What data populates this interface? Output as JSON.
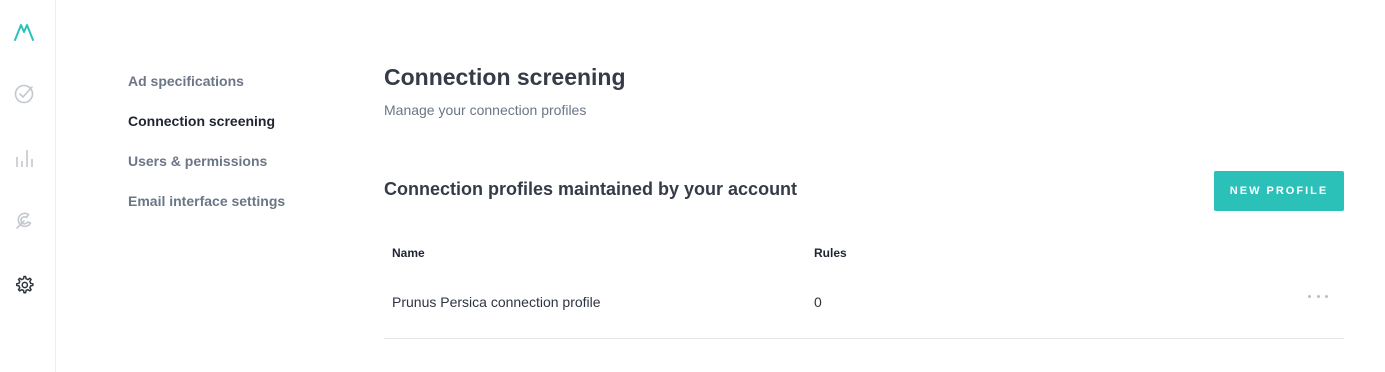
{
  "app": {
    "brand_color": "#2bc1b9"
  },
  "rail": {
    "icons": [
      {
        "name": "logo-icon"
      },
      {
        "name": "check-circle-icon"
      },
      {
        "name": "bar-chart-icon"
      },
      {
        "name": "wrench-icon"
      },
      {
        "name": "gear-icon",
        "active": true
      }
    ]
  },
  "subnav": {
    "items": [
      {
        "label": "Ad specifications"
      },
      {
        "label": "Connection screening",
        "active": true
      },
      {
        "label": "Users & permissions"
      },
      {
        "label": "Email interface settings"
      }
    ]
  },
  "page": {
    "title": "Connection screening",
    "subtitle": "Manage your connection profiles"
  },
  "profiles": {
    "section_title": "Connection profiles maintained by your account",
    "new_button_label": "NEW PROFILE",
    "columns": [
      "Name",
      "Rules"
    ],
    "rows": [
      {
        "name": "Prunus Persica connection profile",
        "rules": "0"
      }
    ]
  }
}
